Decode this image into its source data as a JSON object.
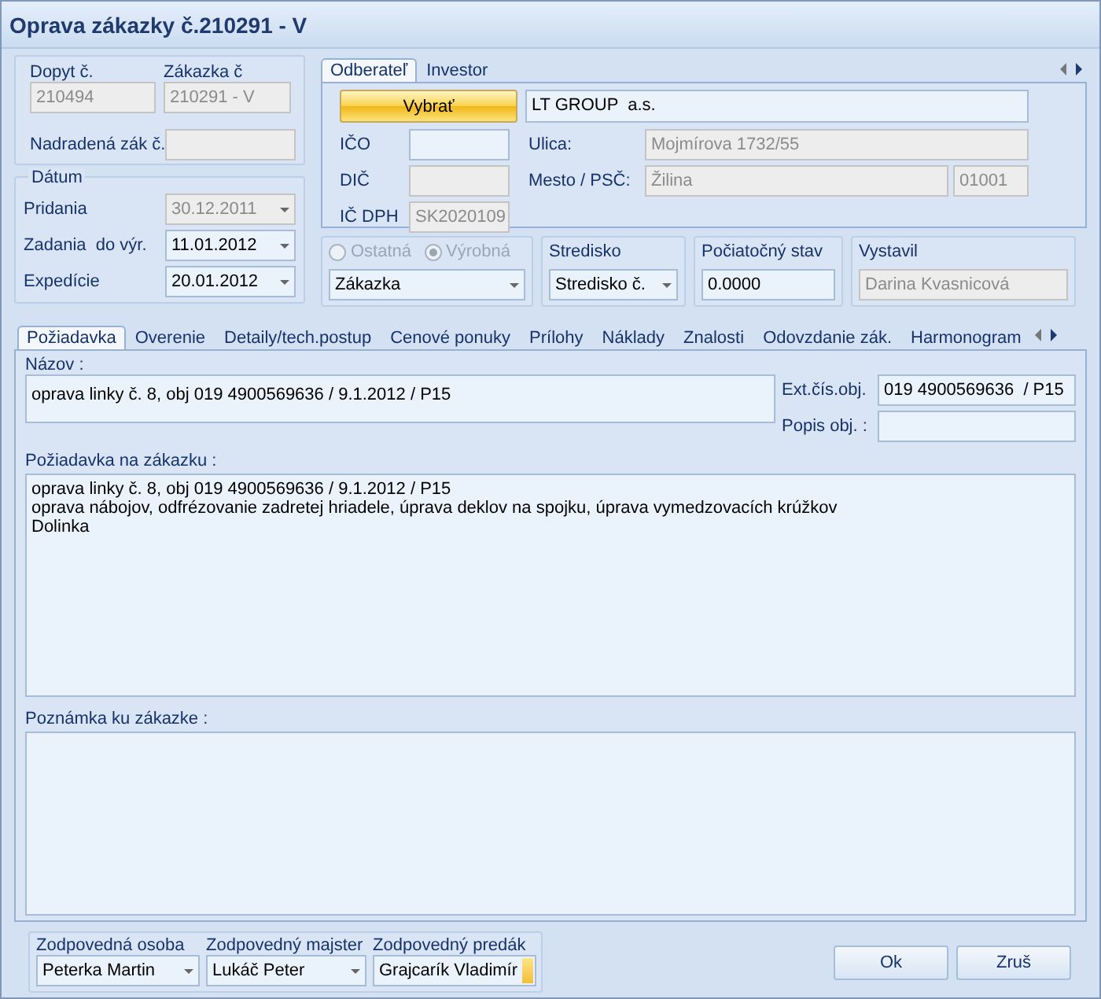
{
  "window": {
    "title": "Oprava zákazky č.210291 - V"
  },
  "header": {
    "fields": [
      {
        "label": "Dopyt č.",
        "value": "210494"
      },
      {
        "label": "Zákazka č",
        "value": "210291 - V"
      }
    ],
    "parent_label": "Nadradená zák č."
  },
  "dates": {
    "legend": "Dátum",
    "rows": [
      {
        "label": "Pridania",
        "value": "30.12.2011",
        "disabled": true
      },
      {
        "label": "Zadania  do výr.",
        "value": "11.01.2012",
        "disabled": false
      },
      {
        "label": "Expedície",
        "value": "20.01.2012",
        "disabled": false
      }
    ]
  },
  "customer": {
    "tabs": [
      {
        "label": "Odberateľ",
        "selected": true
      },
      {
        "label": "Investor",
        "selected": false
      }
    ],
    "select_button": "Vybrať",
    "name": "LT GROUP  a.s.",
    "ico_label": "IČO",
    "dic_label": "DIČ",
    "ic_dph": {
      "label": "IČ DPH",
      "value": "SK2020109"
    },
    "street": {
      "label": "Ulica:",
      "value": "Mojmírova 1732/55"
    },
    "city": {
      "label": "Mesto / PSČ:",
      "value": "Žilina",
      "zip": "01001"
    }
  },
  "type_group": {
    "disabled": true,
    "radios": [
      {
        "label": "Ostatná",
        "selected": false
      },
      {
        "label": "Výrobná",
        "selected": true
      }
    ],
    "combo": "Zákazka"
  },
  "center": {
    "label": "Stredisko",
    "value": "Stredisko č."
  },
  "initial_state": {
    "label": "Počiatočný stav",
    "value": "0.0000"
  },
  "issuer": {
    "label": "Vystavil",
    "value": "Darina Kvasnicová"
  },
  "tabs": [
    {
      "label": "Požiadavka",
      "selected": true
    },
    {
      "label": "Overenie",
      "selected": false
    },
    {
      "label": "Detaily/tech.postup",
      "selected": false
    },
    {
      "label": "Cenové ponuky",
      "selected": false
    },
    {
      "label": "Prílohy",
      "selected": false
    },
    {
      "label": "Náklady",
      "selected": false
    },
    {
      "label": "Znalosti",
      "selected": false
    },
    {
      "label": "Odovzdanie zák.",
      "selected": false
    },
    {
      "label": "Harmonogram",
      "selected": false
    }
  ],
  "request": {
    "name_label": "Názov :",
    "name": "oprava linky č. 8, obj 019 4900569636 / 9.1.2012 / P15",
    "ext_label": "Ext.čís.obj.",
    "ext": "019 4900569636  / P15",
    "desc_label": "Popis obj. :",
    "request_label": "Požiadavka na zákazku :",
    "request_lines": [
      "oprava linky č. 8, obj 019 4900569636 / 9.1.2012 / P15",
      "oprava nábojov, odfrézovanie zadretej hriadele, úprava deklov na spojku, úprava vymedzovacích krúžkov",
      "Dolinka"
    ],
    "note_label": "Poznámka ku zákazke :"
  },
  "responsible": [
    {
      "label": "Zodpovedná osoba",
      "value": "Peterka Martin",
      "focused": false
    },
    {
      "label": "Zodpovedný majster",
      "value": "Lukáč Peter",
      "focused": false
    },
    {
      "label": "Zodpovedný predák",
      "value": "Grajcarík Vladimír",
      "focused": true
    }
  ],
  "buttons": [
    "Ok",
    "Zruš"
  ]
}
